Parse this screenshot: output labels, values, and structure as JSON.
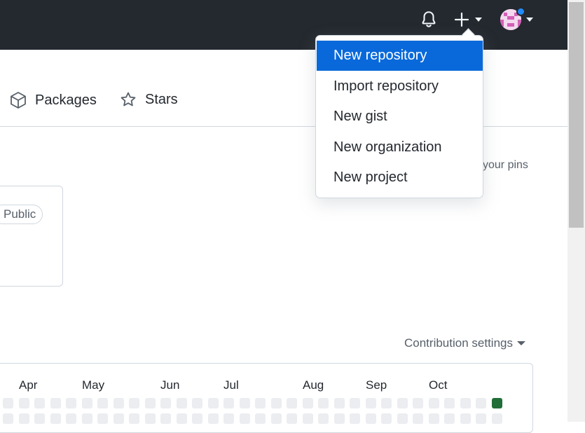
{
  "header": {
    "notifications_icon": "bell-icon",
    "create_icon": "plus-icon",
    "avatar_icon": "avatar"
  },
  "tabs": [
    {
      "label": "Packages",
      "icon": "package-icon"
    },
    {
      "label": "Stars",
      "icon": "star-icon"
    }
  ],
  "pins": {
    "customize_text": "your pins"
  },
  "pinned_repo": {
    "visibility": "Public"
  },
  "contributions": {
    "settings_label": "Contribution settings",
    "months": [
      "Apr",
      "May",
      "Jun",
      "Jul",
      "Aug",
      "Sep",
      "Oct"
    ]
  },
  "create_menu": {
    "items": [
      {
        "label": "New repository",
        "active": true
      },
      {
        "label": "Import repository"
      },
      {
        "label": "New gist"
      },
      {
        "label": "New organization"
      },
      {
        "label": "New project"
      }
    ]
  },
  "colors": {
    "header_bg": "#24292f",
    "accent": "#0969da",
    "contrib_empty": "#ebedf0",
    "contrib_active": "#216e39"
  }
}
